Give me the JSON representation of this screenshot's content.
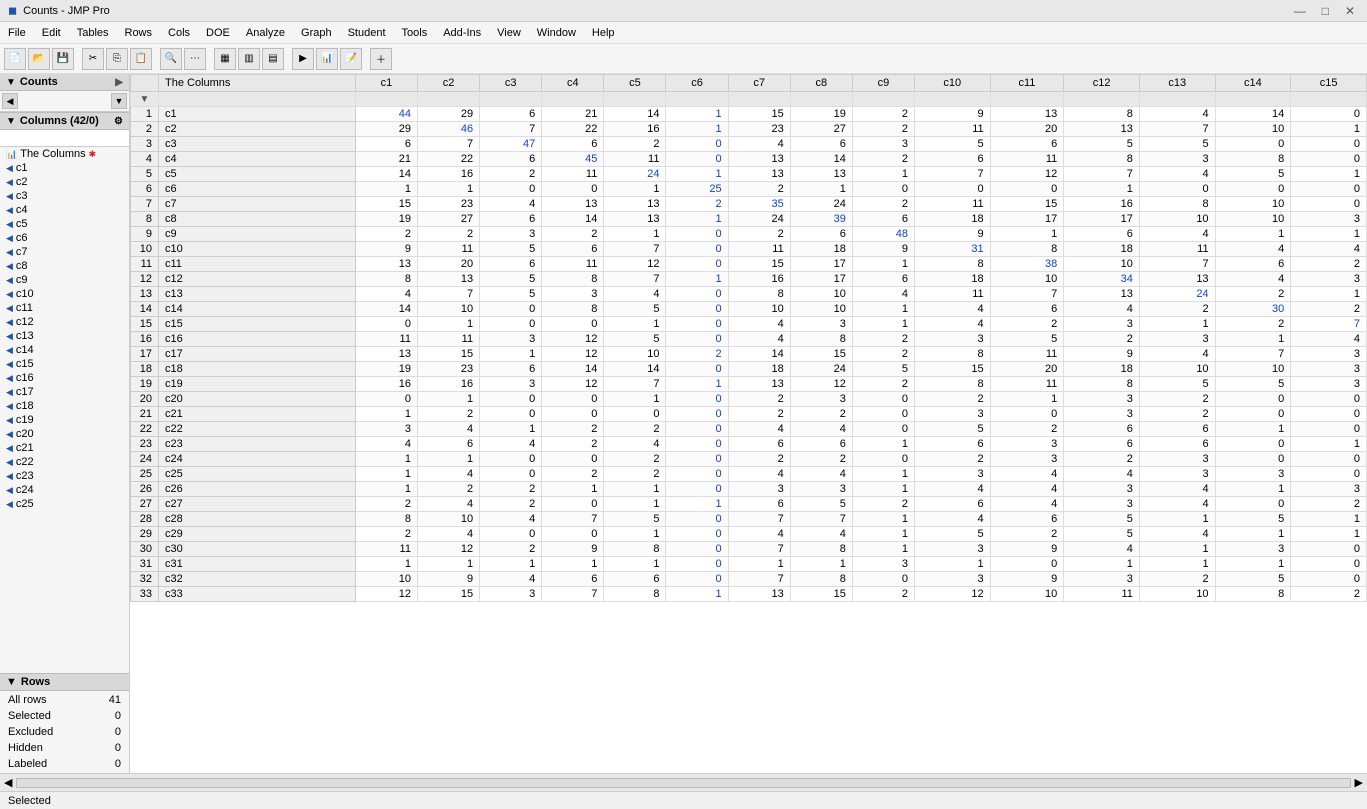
{
  "titlebar": {
    "title": "Counts - JMP Pro",
    "icon": "◼",
    "controls": [
      "—",
      "□",
      "✕"
    ]
  },
  "menubar": {
    "items": [
      "File",
      "Edit",
      "Tables",
      "Rows",
      "Cols",
      "DOE",
      "Analyze",
      "Graph",
      "Student",
      "Tools",
      "Add-Ins",
      "View",
      "Window",
      "Help"
    ]
  },
  "sidebar": {
    "panel_title": "Counts",
    "columns_title": "Columns (42/0)",
    "search_placeholder": "",
    "columns": [
      "The Columns",
      "c1",
      "c2",
      "c3",
      "c4",
      "c5",
      "c6",
      "c7",
      "c8",
      "c9",
      "c10",
      "c11",
      "c12",
      "c13",
      "c14",
      "c15",
      "c16",
      "c17",
      "c18",
      "c19",
      "c20",
      "c21",
      "c22",
      "c23",
      "c24",
      "c25"
    ],
    "rows_title": "Rows",
    "rows": [
      {
        "label": "All rows",
        "value": 41
      },
      {
        "label": "Selected",
        "value": 0
      },
      {
        "label": "Excluded",
        "value": 0
      },
      {
        "label": "Hidden",
        "value": 0
      },
      {
        "label": "Labeled",
        "value": 0
      }
    ]
  },
  "table": {
    "col_headers": [
      "The Columns",
      "c1",
      "c2",
      "c3",
      "c4",
      "c5",
      "c6",
      "c7",
      "c8",
      "c9",
      "c10",
      "c11",
      "c12",
      "c13",
      "c14",
      "c15"
    ],
    "rows": [
      {
        "num": 1,
        "name": "c1",
        "vals": [
          44,
          29,
          6,
          21,
          14,
          1,
          15,
          19,
          2,
          9,
          13,
          8,
          4,
          14,
          0
        ]
      },
      {
        "num": 2,
        "name": "c2",
        "vals": [
          29,
          46,
          7,
          22,
          16,
          1,
          23,
          27,
          2,
          11,
          20,
          13,
          7,
          10,
          1
        ]
      },
      {
        "num": 3,
        "name": "c3",
        "vals": [
          6,
          7,
          47,
          6,
          2,
          0,
          4,
          6,
          3,
          5,
          6,
          5,
          5,
          0,
          0
        ]
      },
      {
        "num": 4,
        "name": "c4",
        "vals": [
          21,
          22,
          6,
          45,
          11,
          0,
          13,
          14,
          2,
          6,
          11,
          8,
          3,
          8,
          0
        ]
      },
      {
        "num": 5,
        "name": "c5",
        "vals": [
          14,
          16,
          2,
          11,
          24,
          1,
          13,
          13,
          1,
          7,
          12,
          7,
          4,
          5,
          1
        ]
      },
      {
        "num": 6,
        "name": "c6",
        "vals": [
          1,
          1,
          0,
          0,
          1,
          25,
          2,
          1,
          0,
          0,
          0,
          1,
          0,
          0,
          0
        ]
      },
      {
        "num": 7,
        "name": "c7",
        "vals": [
          15,
          23,
          4,
          13,
          13,
          2,
          35,
          24,
          2,
          11,
          15,
          16,
          8,
          10,
          0
        ]
      },
      {
        "num": 8,
        "name": "c8",
        "vals": [
          19,
          27,
          6,
          14,
          13,
          1,
          24,
          39,
          6,
          18,
          17,
          17,
          10,
          10,
          3
        ]
      },
      {
        "num": 9,
        "name": "c9",
        "vals": [
          2,
          2,
          3,
          2,
          1,
          0,
          2,
          6,
          48,
          9,
          1,
          6,
          4,
          1,
          1
        ]
      },
      {
        "num": 10,
        "name": "c10",
        "vals": [
          9,
          11,
          5,
          6,
          7,
          0,
          11,
          18,
          9,
          31,
          8,
          18,
          11,
          4,
          4
        ]
      },
      {
        "num": 11,
        "name": "c11",
        "vals": [
          13,
          20,
          6,
          11,
          12,
          0,
          15,
          17,
          1,
          8,
          38,
          10,
          7,
          6,
          2
        ]
      },
      {
        "num": 12,
        "name": "c12",
        "vals": [
          8,
          13,
          5,
          8,
          7,
          1,
          16,
          17,
          6,
          18,
          10,
          34,
          13,
          4,
          3
        ]
      },
      {
        "num": 13,
        "name": "c13",
        "vals": [
          4,
          7,
          5,
          3,
          4,
          0,
          8,
          10,
          4,
          11,
          7,
          13,
          24,
          2,
          1
        ]
      },
      {
        "num": 14,
        "name": "c14",
        "vals": [
          14,
          10,
          0,
          8,
          5,
          0,
          10,
          10,
          1,
          4,
          6,
          4,
          2,
          30,
          2
        ]
      },
      {
        "num": 15,
        "name": "c15",
        "vals": [
          0,
          1,
          0,
          0,
          1,
          0,
          4,
          3,
          1,
          4,
          2,
          3,
          1,
          2,
          7
        ]
      },
      {
        "num": 16,
        "name": "c16",
        "vals": [
          11,
          11,
          3,
          12,
          5,
          0,
          4,
          8,
          2,
          3,
          5,
          2,
          3,
          1,
          4
        ]
      },
      {
        "num": 17,
        "name": "c17",
        "vals": [
          13,
          15,
          1,
          12,
          10,
          2,
          14,
          15,
          2,
          8,
          11,
          9,
          4,
          7,
          3
        ]
      },
      {
        "num": 18,
        "name": "c18",
        "vals": [
          19,
          23,
          6,
          14,
          14,
          0,
          18,
          24,
          5,
          15,
          20,
          18,
          10,
          10,
          3
        ]
      },
      {
        "num": 19,
        "name": "c19",
        "vals": [
          16,
          16,
          3,
          12,
          7,
          1,
          13,
          12,
          2,
          8,
          11,
          8,
          5,
          5,
          3
        ]
      },
      {
        "num": 20,
        "name": "c20",
        "vals": [
          0,
          1,
          0,
          0,
          1,
          0,
          2,
          3,
          0,
          2,
          1,
          3,
          2,
          0,
          0
        ]
      },
      {
        "num": 21,
        "name": "c21",
        "vals": [
          1,
          2,
          0,
          0,
          0,
          0,
          2,
          2,
          0,
          3,
          0,
          3,
          2,
          0,
          0
        ]
      },
      {
        "num": 22,
        "name": "c22",
        "vals": [
          3,
          4,
          1,
          2,
          2,
          0,
          4,
          4,
          0,
          5,
          2,
          6,
          6,
          1,
          0
        ]
      },
      {
        "num": 23,
        "name": "c23",
        "vals": [
          4,
          6,
          4,
          2,
          4,
          0,
          6,
          6,
          1,
          6,
          3,
          6,
          6,
          0,
          1
        ]
      },
      {
        "num": 24,
        "name": "c24",
        "vals": [
          1,
          1,
          0,
          0,
          2,
          0,
          2,
          2,
          0,
          2,
          3,
          2,
          3,
          0,
          0
        ]
      },
      {
        "num": 25,
        "name": "c25",
        "vals": [
          1,
          4,
          0,
          2,
          2,
          0,
          4,
          4,
          1,
          3,
          4,
          4,
          3,
          3,
          0
        ]
      },
      {
        "num": 26,
        "name": "c26",
        "vals": [
          1,
          2,
          2,
          1,
          1,
          0,
          3,
          3,
          1,
          4,
          4,
          3,
          4,
          1,
          3
        ]
      },
      {
        "num": 27,
        "name": "c27",
        "vals": [
          2,
          4,
          2,
          0,
          1,
          1,
          6,
          5,
          2,
          6,
          4,
          3,
          4,
          0,
          2
        ]
      },
      {
        "num": 28,
        "name": "c28",
        "vals": [
          8,
          10,
          4,
          7,
          5,
          0,
          7,
          7,
          1,
          4,
          6,
          5,
          1,
          5,
          1
        ]
      },
      {
        "num": 29,
        "name": "c29",
        "vals": [
          2,
          4,
          0,
          0,
          1,
          0,
          4,
          4,
          1,
          5,
          2,
          5,
          4,
          1,
          1
        ]
      },
      {
        "num": 30,
        "name": "c30",
        "vals": [
          11,
          12,
          2,
          9,
          8,
          0,
          7,
          8,
          1,
          3,
          9,
          4,
          1,
          3,
          0
        ]
      },
      {
        "num": 31,
        "name": "c31",
        "vals": [
          1,
          1,
          1,
          1,
          1,
          0,
          1,
          1,
          3,
          1,
          0,
          1,
          1,
          1,
          0
        ]
      },
      {
        "num": 32,
        "name": "c32",
        "vals": [
          10,
          9,
          4,
          6,
          6,
          0,
          7,
          8,
          0,
          3,
          9,
          3,
          2,
          5,
          0
        ]
      },
      {
        "num": 33,
        "name": "c33",
        "vals": [
          12,
          15,
          3,
          7,
          8,
          1,
          13,
          15,
          2,
          12,
          10,
          11,
          10,
          8,
          2
        ]
      }
    ]
  },
  "status": {
    "selected_label": "Selected"
  },
  "colors": {
    "blue": "#1144cc",
    "black": "#000000",
    "header_bg": "#e8e8e8",
    "sidebar_bg": "#f5f5f5"
  }
}
